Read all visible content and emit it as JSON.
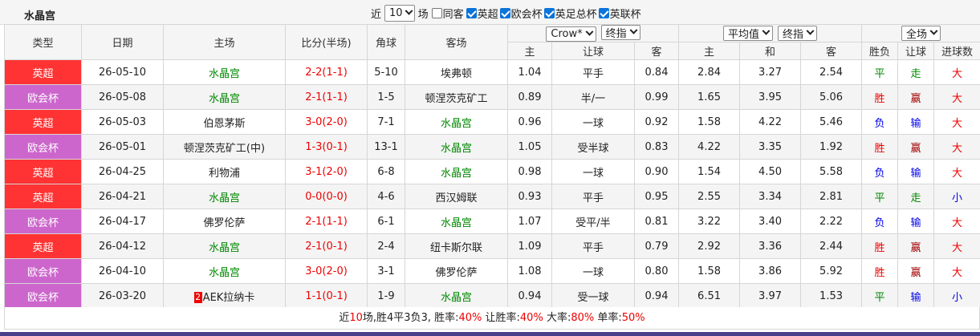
{
  "team_title": "水晶宫",
  "filters": {
    "near_label": "近",
    "count_value": "10",
    "games_label": "场",
    "same_home_away": {
      "label": "同客",
      "checked": false
    },
    "leagues": [
      {
        "label": "英超",
        "checked": true
      },
      {
        "label": "欧会杯",
        "checked": true
      },
      {
        "label": "英足总杯",
        "checked": true
      },
      {
        "label": "英联杯",
        "checked": true
      }
    ]
  },
  "header": {
    "type": "类型",
    "date": "日期",
    "home": "主场",
    "score": "比分(半场)",
    "corners": "角球",
    "away": "客场",
    "company_select": "Crow*",
    "odds_select": "终指",
    "avg_select": "平均值",
    "avg_odds_select": "终指",
    "period_select": "全场",
    "sub_home": "主",
    "sub_handicap": "让球",
    "sub_away": "客",
    "sub_avg_home": "主",
    "sub_avg_draw": "和",
    "sub_avg_away": "客",
    "sub_result": "胜负",
    "sub_handicap_result": "让球",
    "sub_goals": "进球数"
  },
  "colors": {
    "league_premier": "#ff3333",
    "league_conference": "#cc66cc"
  },
  "rows": [
    {
      "league": "英超",
      "league_color": "#ff3333",
      "date": "26-05-10",
      "home": "水晶宫",
      "home_highlight": true,
      "tag": "",
      "score": "2-2(1-1)",
      "corners": "5-10",
      "away": "埃弗顿",
      "away_highlight": false,
      "o_home": "1.04",
      "o_hcp": "平手",
      "o_away": "0.84",
      "a_home": "2.84",
      "a_draw": "3.27",
      "a_away": "2.54",
      "result": "平",
      "result_color": "#008800",
      "hcp_result": "走",
      "hcp_color": "#008800",
      "goals": "大",
      "goals_color": "#ee0000"
    },
    {
      "league": "欧会杯",
      "league_color": "#cc66cc",
      "date": "26-05-08",
      "home": "水晶宫",
      "home_highlight": true,
      "tag": "",
      "score": "2-1(1-1)",
      "corners": "1-5",
      "away": "顿涅茨克矿工",
      "away_highlight": false,
      "o_home": "0.89",
      "o_hcp": "半/一",
      "o_away": "0.99",
      "a_home": "1.65",
      "a_draw": "3.95",
      "a_away": "5.06",
      "result": "胜",
      "result_color": "#ee0000",
      "hcp_result": "赢",
      "hcp_color": "#a00000",
      "goals": "大",
      "goals_color": "#ee0000"
    },
    {
      "league": "英超",
      "league_color": "#ff3333",
      "date": "26-05-03",
      "home": "伯恩茅斯",
      "home_highlight": false,
      "tag": "",
      "score": "3-0(2-0)",
      "corners": "7-1",
      "away": "水晶宫",
      "away_highlight": true,
      "o_home": "0.96",
      "o_hcp": "一球",
      "o_away": "0.92",
      "a_home": "1.58",
      "a_draw": "4.22",
      "a_away": "5.46",
      "result": "负",
      "result_color": "#0000ee",
      "hcp_result": "输",
      "hcp_color": "#0000ee",
      "goals": "大",
      "goals_color": "#ee0000"
    },
    {
      "league": "欧会杯",
      "league_color": "#cc66cc",
      "date": "26-05-01",
      "home": "顿涅茨克矿工(中)",
      "home_highlight": false,
      "tag": "",
      "score": "1-3(0-1)",
      "corners": "13-1",
      "away": "水晶宫",
      "away_highlight": true,
      "o_home": "1.05",
      "o_hcp": "受半球",
      "o_away": "0.83",
      "a_home": "4.22",
      "a_draw": "3.35",
      "a_away": "1.92",
      "result": "胜",
      "result_color": "#ee0000",
      "hcp_result": "赢",
      "hcp_color": "#a00000",
      "goals": "大",
      "goals_color": "#ee0000"
    },
    {
      "league": "英超",
      "league_color": "#ff3333",
      "date": "26-04-25",
      "home": "利物浦",
      "home_highlight": false,
      "tag": "",
      "score": "3-1(2-0)",
      "corners": "6-8",
      "away": "水晶宫",
      "away_highlight": true,
      "o_home": "0.98",
      "o_hcp": "一球",
      "o_away": "0.90",
      "a_home": "1.54",
      "a_draw": "4.50",
      "a_away": "5.58",
      "result": "负",
      "result_color": "#0000ee",
      "hcp_result": "输",
      "hcp_color": "#0000ee",
      "goals": "大",
      "goals_color": "#ee0000"
    },
    {
      "league": "英超",
      "league_color": "#ff3333",
      "date": "26-04-21",
      "home": "水晶宫",
      "home_highlight": true,
      "tag": "",
      "score": "0-0(0-0)",
      "corners": "4-6",
      "away": "西汉姆联",
      "away_highlight": false,
      "o_home": "0.93",
      "o_hcp": "平手",
      "o_away": "0.95",
      "a_home": "2.55",
      "a_draw": "3.34",
      "a_away": "2.81",
      "result": "平",
      "result_color": "#008800",
      "hcp_result": "走",
      "hcp_color": "#008800",
      "goals": "小",
      "goals_color": "#0000ee"
    },
    {
      "league": "欧会杯",
      "league_color": "#cc66cc",
      "date": "26-04-17",
      "home": "佛罗伦萨",
      "home_highlight": false,
      "tag": "",
      "score": "2-1(1-1)",
      "corners": "6-1",
      "away": "水晶宫",
      "away_highlight": true,
      "o_home": "1.07",
      "o_hcp": "受平/半",
      "o_away": "0.81",
      "a_home": "3.22",
      "a_draw": "3.40",
      "a_away": "2.22",
      "result": "负",
      "result_color": "#0000ee",
      "hcp_result": "输",
      "hcp_color": "#0000ee",
      "goals": "大",
      "goals_color": "#ee0000"
    },
    {
      "league": "英超",
      "league_color": "#ff3333",
      "date": "26-04-12",
      "home": "水晶宫",
      "home_highlight": true,
      "tag": "",
      "score": "2-1(0-1)",
      "corners": "2-4",
      "away": "纽卡斯尔联",
      "away_highlight": false,
      "o_home": "1.09",
      "o_hcp": "平手",
      "o_away": "0.79",
      "a_home": "2.92",
      "a_draw": "3.36",
      "a_away": "2.44",
      "result": "胜",
      "result_color": "#ee0000",
      "hcp_result": "赢",
      "hcp_color": "#a00000",
      "goals": "大",
      "goals_color": "#ee0000"
    },
    {
      "league": "欧会杯",
      "league_color": "#cc66cc",
      "date": "26-04-10",
      "home": "水晶宫",
      "home_highlight": true,
      "tag": "",
      "score": "3-0(2-0)",
      "corners": "3-1",
      "away": "佛罗伦萨",
      "away_highlight": false,
      "o_home": "1.08",
      "o_hcp": "一球",
      "o_away": "0.80",
      "a_home": "1.58",
      "a_draw": "3.86",
      "a_away": "5.92",
      "result": "胜",
      "result_color": "#ee0000",
      "hcp_result": "赢",
      "hcp_color": "#a00000",
      "goals": "大",
      "goals_color": "#ee0000"
    },
    {
      "league": "欧会杯",
      "league_color": "#cc66cc",
      "date": "26-03-20",
      "home": "AEK拉纳卡",
      "home_highlight": false,
      "tag": "2",
      "score": "1-1(0-1)",
      "corners": "1-9",
      "away": "水晶宫",
      "away_highlight": true,
      "o_home": "0.94",
      "o_hcp": "受一球",
      "o_away": "0.94",
      "a_home": "6.51",
      "a_draw": "3.97",
      "a_away": "1.53",
      "result": "平",
      "result_color": "#008800",
      "hcp_result": "输",
      "hcp_color": "#0000ee",
      "goals": "小",
      "goals_color": "#0000ee"
    }
  ],
  "summary": {
    "t1": "近",
    "games": "10",
    "t2": "场,胜4平3负3, 胜率:",
    "win_rate": "40%",
    "t3": " 让胜率:",
    "hcp_rate": "40%",
    "t4": " 大率:",
    "over_rate": "80%",
    "t5": " 单率:",
    "odd_rate": "50%"
  }
}
